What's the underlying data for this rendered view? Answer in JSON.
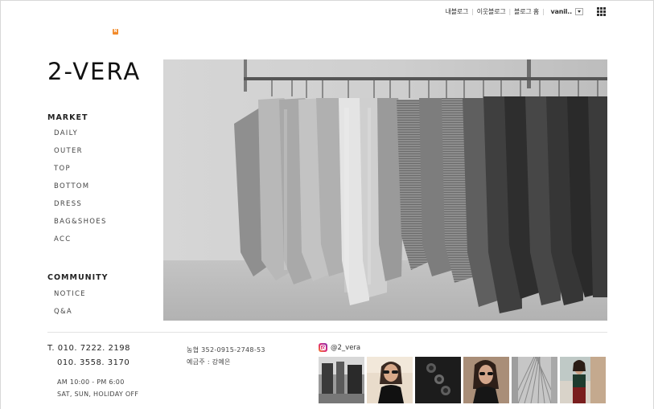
{
  "topnav": {
    "my_blog": "내블로그",
    "neighbor_blog": "이웃블로그",
    "blog_home": "블로그 홈",
    "user": "vanil.."
  },
  "logo": "2-VERA",
  "menu": {
    "market_heading": "MARKET",
    "market_items": [
      "DAILY",
      "OUTER",
      "TOP",
      "BOTTOM",
      "DRESS",
      "BAG&SHOES",
      "ACC"
    ],
    "community_heading": "COMMUNITY",
    "community_items": [
      "NOTICE",
      "Q&A"
    ]
  },
  "footer": {
    "phone_1": "T. 010. 7222. 2198",
    "phone_2": "010. 3558. 3170",
    "hours_1": "AM 10:00 - PM 6:00",
    "hours_2": "SAT, SUN, HOLIDAY OFF",
    "bank_line": "농협  352-0915-2748-53",
    "depositor": "예금주 : 강예은",
    "instagram_handle": "@2_vera"
  },
  "icons": {
    "new_badge": "new-icon",
    "dropdown": "chevron-down-icon",
    "apps": "grid-icon",
    "instagram": "instagram-icon"
  },
  "colors": {
    "new_badge": "#f28a2a",
    "text": "#222222"
  }
}
